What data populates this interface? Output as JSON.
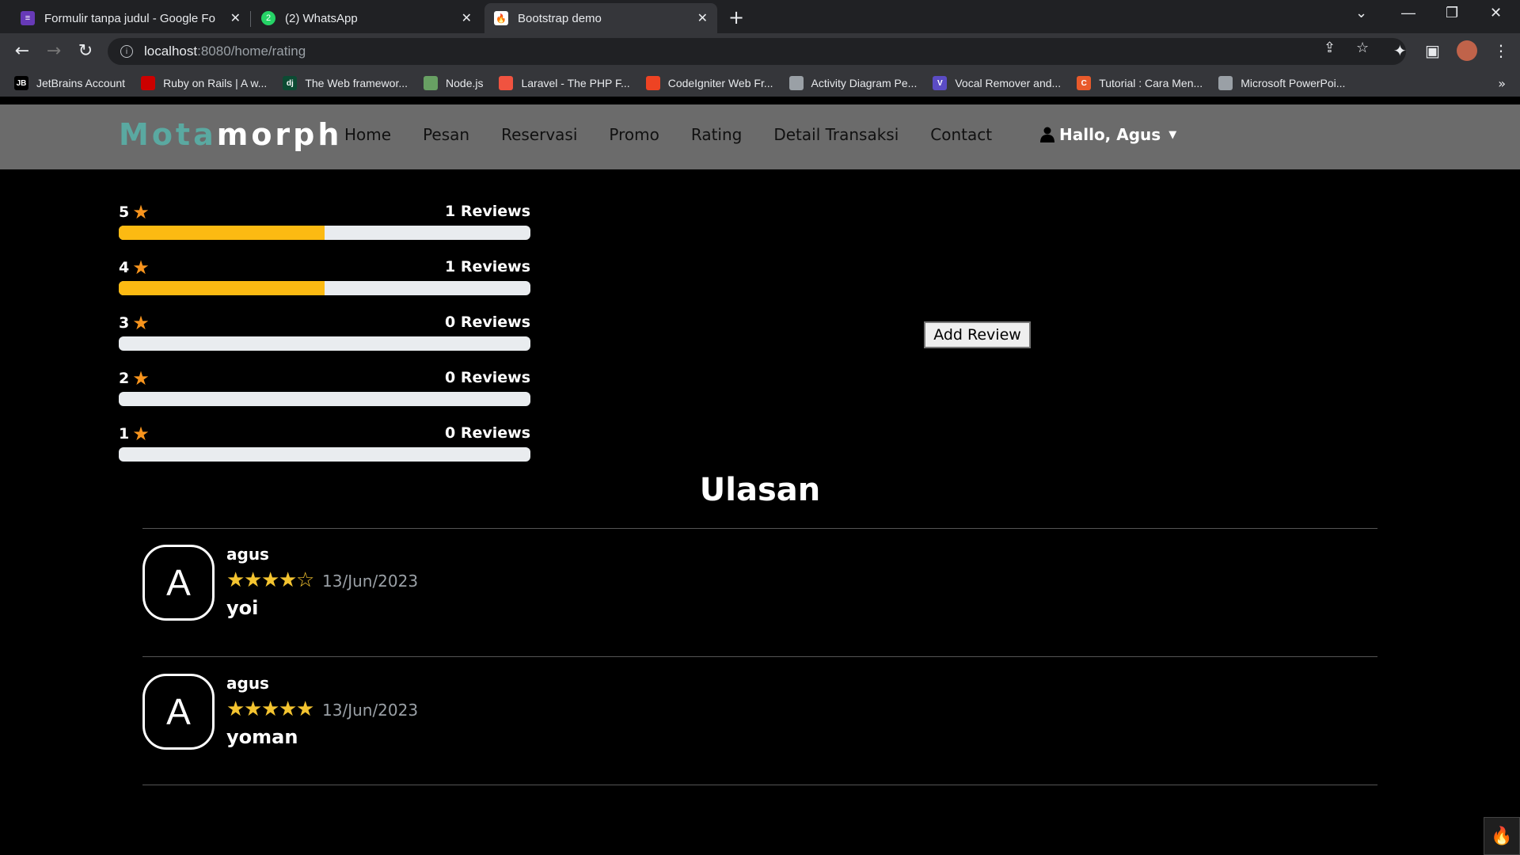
{
  "browser": {
    "tabs": [
      {
        "title": "Formulir tanpa judul - Google Fo",
        "icon": "forms-icon",
        "color": "#673ab7",
        "active": false
      },
      {
        "title": "(2) WhatsApp",
        "icon": "whatsapp-icon",
        "color": "#25d366",
        "active": false
      },
      {
        "title": "Bootstrap demo",
        "icon": "codeigniter-icon",
        "color": "#ee4323",
        "active": true
      }
    ],
    "url_host": "localhost",
    "url_path": ":8080/home/rating",
    "bookmarks": [
      {
        "label": "JetBrains Account",
        "badge": "JB",
        "color": "#000000"
      },
      {
        "label": "Ruby on Rails | A w...",
        "badge": "",
        "color": "#cc0000"
      },
      {
        "label": "The Web framewor...",
        "badge": "dj",
        "color": "#0c4b33"
      },
      {
        "label": "Node.js",
        "badge": "",
        "color": "#68a063"
      },
      {
        "label": "Laravel - The PHP F...",
        "badge": "",
        "color": "#f05340"
      },
      {
        "label": "CodeIgniter Web Fr...",
        "badge": "",
        "color": "#ee4323"
      },
      {
        "label": "Activity Diagram Pe...",
        "badge": "",
        "color": "#9aa0a6"
      },
      {
        "label": "Vocal Remover and...",
        "badge": "V",
        "color": "#5b4cc4"
      },
      {
        "label": "Tutorial : Cara Men...",
        "badge": "C",
        "color": "#e85a2b"
      },
      {
        "label": "Microsoft PowerPoi...",
        "badge": "",
        "color": "#9aa0a6"
      }
    ],
    "more": "»"
  },
  "navbar": {
    "brand_part1": "Mota",
    "brand_part2": "morph",
    "links": [
      "Home",
      "Pesan",
      "Reservasi",
      "Promo",
      "Rating",
      "Detail Transaksi",
      "Contact"
    ],
    "user": "Hallo, Agus"
  },
  "ratings": [
    {
      "stars": "5",
      "count_label": "1 Reviews",
      "fill": 0.5
    },
    {
      "stars": "4",
      "count_label": "1 Reviews",
      "fill": 0.5
    },
    {
      "stars": "3",
      "count_label": "0 Reviews",
      "fill": 0
    },
    {
      "stars": "2",
      "count_label": "0 Reviews",
      "fill": 0
    },
    {
      "stars": "1",
      "count_label": "0 Reviews",
      "fill": 0
    }
  ],
  "add_review_label": "Add Review",
  "section_title": "Ulasan",
  "reviews": [
    {
      "initial": "A",
      "name": "agus",
      "rating": 4,
      "date": "13/Jun/2023",
      "text": "yoi"
    },
    {
      "initial": "A",
      "name": "agus",
      "rating": 5,
      "date": "13/Jun/2023",
      "text": "yoman"
    }
  ],
  "colors": {
    "brand_accent": "#5aa9a1",
    "bar_fill": "#fcba12",
    "star": "#f4c430",
    "label_star": "#f7941d"
  }
}
